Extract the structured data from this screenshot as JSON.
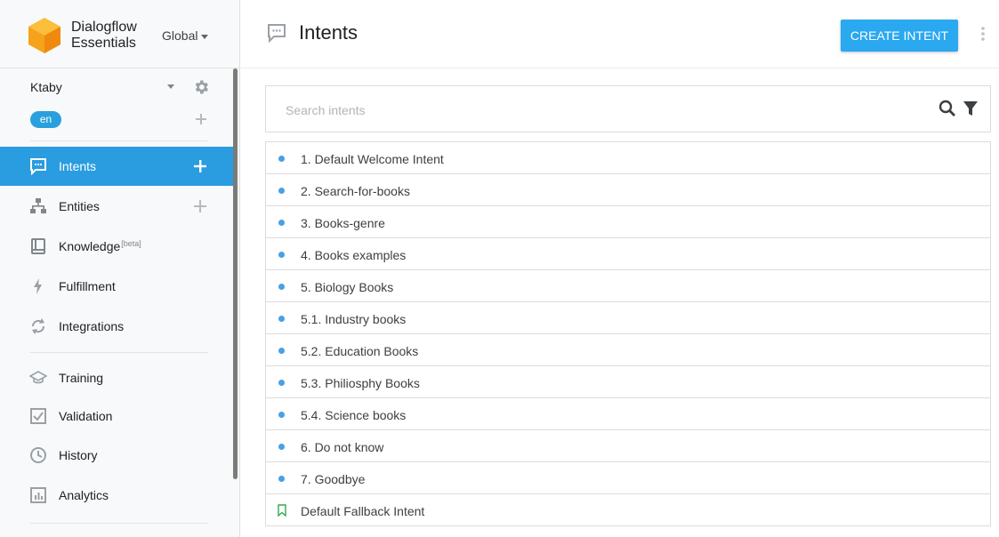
{
  "brand": {
    "line1": "Dialogflow",
    "line2": "Essentials",
    "region": "Global"
  },
  "agent": {
    "name": "Ktaby",
    "language": "en"
  },
  "nav": {
    "intents": "Intents",
    "entities": "Entities",
    "knowledge": "Knowledge",
    "knowledge_badge": "[beta]",
    "fulfillment": "Fulfillment",
    "integrations": "Integrations",
    "training": "Training",
    "validation": "Validation",
    "history": "History",
    "analytics": "Analytics"
  },
  "header": {
    "title": "Intents",
    "create_label": "CREATE INTENT"
  },
  "search": {
    "placeholder": "Search intents"
  },
  "intents": [
    "1. Default Welcome Intent",
    "2. Search-for-books",
    "3. Books-genre",
    "4. Books examples",
    "5. Biology Books",
    "5.1. Industry books",
    "5.2. Education Books",
    "5.3. Philiosphy Books",
    "5.4. Science books",
    "6. Do not know",
    "7. Goodbye",
    "Default Fallback Intent"
  ],
  "colors": {
    "accent": "#2a9ce0",
    "button": "#2aa8f0",
    "dot": "#4a9fe0",
    "logo": "#f39c12",
    "fallback_icon": "#34a853"
  }
}
